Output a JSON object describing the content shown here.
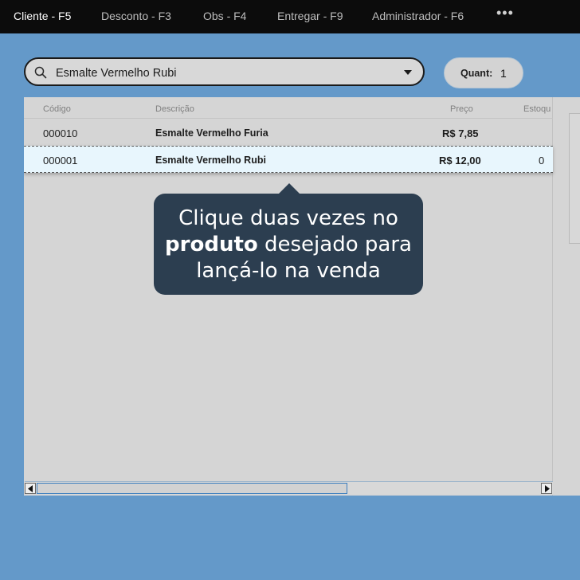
{
  "menu": {
    "items": [
      {
        "label": "Cliente - F5",
        "active": true
      },
      {
        "label": "Desconto - F3"
      },
      {
        "label": "Obs - F4"
      },
      {
        "label": "Entregar - F9"
      },
      {
        "label": "Administrador - F6"
      }
    ],
    "more_label": "•••"
  },
  "search": {
    "value": "Esmalte Vermelho Rubi",
    "icons": {
      "left": "search-icon",
      "right": "chevron-down-icon"
    }
  },
  "quantity": {
    "label": "Quant:",
    "value": "1"
  },
  "table": {
    "columns": [
      "Código",
      "Descrição",
      "Preço",
      "Estoqu"
    ],
    "rows": [
      {
        "codigo": "000010",
        "descricao": "Esmalte Vermelho Furia",
        "preco": "R$ 7,85",
        "estoque": ""
      },
      {
        "codigo": "000001",
        "descricao": "Esmalte Vermelho Rubi",
        "preco": "R$ 12,00",
        "estoque": "0",
        "selected": true
      }
    ]
  },
  "tooltip": {
    "line1": "Clique duas vezes no",
    "line2_bold": "produto",
    "line2_rest": " desejado para",
    "line3": "lançá-lo na venda"
  },
  "colors": {
    "background": "#6499c9",
    "topbar": "#0c0c0c",
    "tooltip": "#2c3e50",
    "selected_row": "#e8f6fd",
    "scroll_thumb_border": "#3d7fbf"
  }
}
